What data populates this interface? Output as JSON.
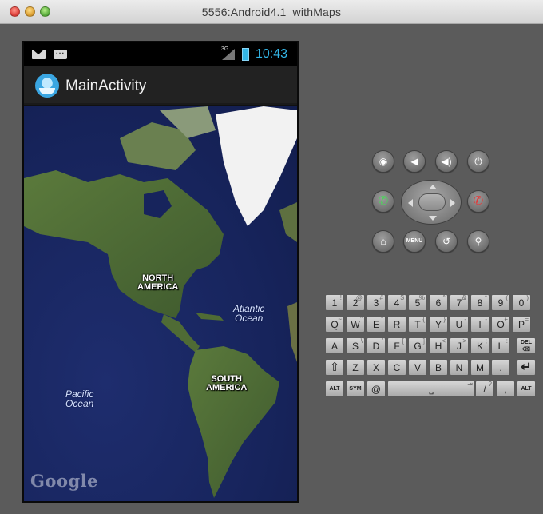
{
  "window": {
    "title": "5556:Android4.1_withMaps"
  },
  "status_bar": {
    "network": "3G",
    "time": "10:43"
  },
  "action_bar": {
    "title": "MainActivity"
  },
  "map": {
    "labels": {
      "north_america_1": "NORTH",
      "north_america_2": "AMERICA",
      "south_america_1": "SOUTH",
      "south_america_2": "AMERICA",
      "atlantic_1": "Atlantic",
      "atlantic_2": "Ocean",
      "pacific_1": "Pacific",
      "pacific_2": "Ocean"
    },
    "logo": "Google",
    "colors": {
      "ocean": "#17245c",
      "land": "#4d6b33",
      "ice": "#f2f2f2"
    }
  },
  "hardware": {
    "menu_label": "MENU"
  },
  "keyboard": {
    "row1": [
      {
        "k": "1",
        "a": "!"
      },
      {
        "k": "2",
        "a": "@"
      },
      {
        "k": "3",
        "a": "#"
      },
      {
        "k": "4",
        "a": "$"
      },
      {
        "k": "5",
        "a": "%"
      },
      {
        "k": "6",
        "a": "^"
      },
      {
        "k": "7",
        "a": "&"
      },
      {
        "k": "8",
        "a": "*"
      },
      {
        "k": "9",
        "a": "("
      },
      {
        "k": "0",
        "a": ")"
      }
    ],
    "row2": [
      {
        "k": "Q",
        "a": "~"
      },
      {
        "k": "W",
        "a": "\""
      },
      {
        "k": "E",
        "a": "\""
      },
      {
        "k": "R",
        "a": ""
      },
      {
        "k": "T",
        "a": "{"
      },
      {
        "k": "Y",
        "a": "}"
      },
      {
        "k": "U",
        "a": "-"
      },
      {
        "k": "I",
        "a": "-"
      },
      {
        "k": "O",
        "a": "+"
      },
      {
        "k": "P",
        "a": "="
      }
    ],
    "row3": [
      {
        "k": "A",
        "a": ""
      },
      {
        "k": "S",
        "a": "\\"
      },
      {
        "k": "D",
        "a": "'"
      },
      {
        "k": "F",
        "a": "["
      },
      {
        "k": "G",
        "a": "]"
      },
      {
        "k": "H",
        "a": "<"
      },
      {
        "k": "J",
        "a": ">"
      },
      {
        "k": "K",
        "a": ";"
      },
      {
        "k": "L",
        "a": ":"
      }
    ],
    "del_1": "DEL",
    "row4": [
      {
        "k": "Z",
        "a": ""
      },
      {
        "k": "X",
        "a": ""
      },
      {
        "k": "C",
        "a": ""
      },
      {
        "k": "V",
        "a": ""
      },
      {
        "k": "B",
        "a": ""
      },
      {
        "k": "N",
        "a": ""
      },
      {
        "k": "M",
        "a": ""
      },
      {
        "k": ".",
        "a": ""
      }
    ],
    "alt_label": "ALT",
    "sym_label": "SYM",
    "at_label": "@",
    "slash_label": "/",
    "question_label": "?",
    "comma_label": ","
  }
}
